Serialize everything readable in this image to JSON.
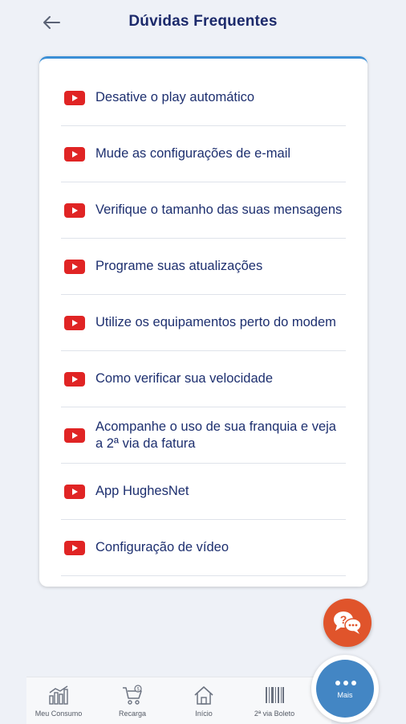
{
  "header": {
    "title": "Dúvidas Frequentes"
  },
  "faq": {
    "items": [
      {
        "label": "Desative o play automático"
      },
      {
        "label": "Mude as configurações de e-mail"
      },
      {
        "label": "Verifique o tamanho das suas mensagens"
      },
      {
        "label": "Programe suas atualizações"
      },
      {
        "label": "Utilize os equipamentos perto do modem"
      },
      {
        "label": "Como verificar sua velocidade"
      },
      {
        "label": "Acompanhe o uso de sua franquia e veja a 2ª via da fatura"
      },
      {
        "label": "App HughesNet"
      },
      {
        "label": "Configuração de vídeo"
      }
    ]
  },
  "nav": {
    "items": [
      {
        "label": "Meu Consumo",
        "icon": "bar-chart-icon"
      },
      {
        "label": "Recarga",
        "icon": "cart-icon"
      },
      {
        "label": "Início",
        "icon": "home-icon"
      },
      {
        "label": "2ª via Boleto",
        "icon": "barcode-icon"
      }
    ],
    "more_label": "Mais"
  },
  "colors": {
    "primary": "#1c2a6b",
    "accent": "#3b8fd6",
    "youtube_red": "#e02424",
    "help_orange": "#e0542b",
    "more_blue": "#4386c4"
  }
}
